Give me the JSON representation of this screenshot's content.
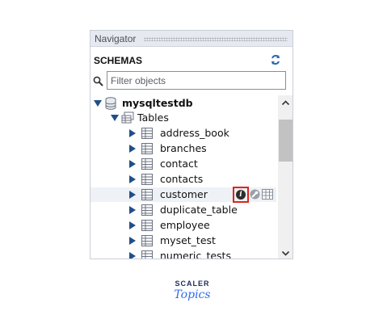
{
  "navigator": {
    "title": "Navigator",
    "schemas_label": "SCHEMAS",
    "filter_placeholder": "Filter objects"
  },
  "tree": {
    "schema_name": "mysqltestdb",
    "tables_label": "Tables",
    "tables": [
      "address_book",
      "branches",
      "contact",
      "contacts",
      "customer",
      "duplicate_table",
      "employee",
      "myset_test",
      "numeric_tests"
    ],
    "hovered_table": "customer",
    "hover_actions": [
      "info-icon",
      "wrench-icon",
      "table-data-icon"
    ],
    "info_glyph": "i"
  },
  "branding": {
    "line1": "SCALER",
    "line2": "Topics"
  },
  "colors": {
    "arrow": "#1f4f8a",
    "highlight_border": "#e0241c",
    "brand_dark": "#1c2a59",
    "brand_accent": "#2d6cf0"
  }
}
